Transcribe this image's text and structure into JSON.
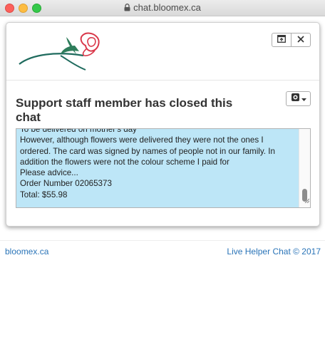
{
  "browser": {
    "url": "chat.bloomex.ca"
  },
  "chat": {
    "status_title": "Support staff member has closed this chat",
    "message_lines": [
      "To be delivered on mother's day",
      "However, although flowers were delivered they were not the ones I",
      "ordered. The card was signed by names of people not in our family. In",
      "addition the flowers were not the colour scheme I paid for",
      "Please advice...",
      "Order Number 02065373",
      "Total: $55.98"
    ]
  },
  "footer": {
    "left_link": "bloomex.ca",
    "right_link": "Live Helper Chat © 2017"
  },
  "colors": {
    "message_bg": "#bde6f7",
    "link": "#2a74b8",
    "rose": "#d9384a",
    "stem": "#1f6b5e"
  },
  "icons": {
    "logo": "rose-logo-icon",
    "popout": "popout-window-icon",
    "close": "close-icon",
    "settings": "gear-icon",
    "lock": "lock-icon"
  }
}
